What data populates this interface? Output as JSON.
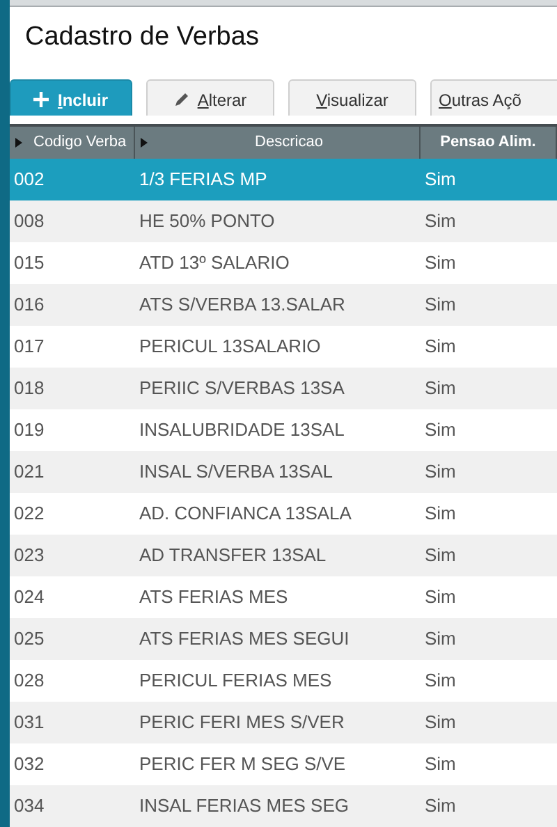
{
  "title": "Cadastro de Verbas",
  "buttons": [
    {
      "label": "Incluir",
      "kind": "add"
    },
    {
      "label": "Alterar",
      "kind": "edit"
    },
    {
      "label": "Visualizar",
      "kind": "plain"
    },
    {
      "label": "Outras Açõ",
      "kind": "plain"
    }
  ],
  "table": {
    "columns": [
      {
        "label": "Codigo Verba",
        "sortable": true
      },
      {
        "label": "Descricao",
        "sortable": true
      },
      {
        "label": "Pensao Alim.",
        "sortable": false
      }
    ],
    "rows": [
      {
        "cells": [
          "002",
          "1/3 FERIAS MP",
          "Sim"
        ],
        "selected": true
      },
      {
        "cells": [
          "008",
          "HE 50% PONTO",
          "Sim"
        ],
        "selected": false
      },
      {
        "cells": [
          "015",
          "ATD 13º SALARIO",
          "Sim"
        ],
        "selected": false
      },
      {
        "cells": [
          "016",
          "ATS S/VERBA 13.SALAR",
          "Sim"
        ],
        "selected": false
      },
      {
        "cells": [
          "017",
          "PERICUL 13SALARIO",
          "Sim"
        ],
        "selected": false
      },
      {
        "cells": [
          "018",
          "PERIIC S/VERBAS 13SA",
          "Sim"
        ],
        "selected": false
      },
      {
        "cells": [
          "019",
          "INSALUBRIDADE 13SAL",
          "Sim"
        ],
        "selected": false
      },
      {
        "cells": [
          "021",
          "INSAL S/VERBA 13SAL",
          "Sim"
        ],
        "selected": false
      },
      {
        "cells": [
          "022",
          "AD. CONFIANCA 13SALA",
          "Sim"
        ],
        "selected": false
      },
      {
        "cells": [
          "023",
          "AD TRANSFER 13SAL",
          "Sim"
        ],
        "selected": false
      },
      {
        "cells": [
          "024",
          "ATS FERIAS MES",
          "Sim"
        ],
        "selected": false
      },
      {
        "cells": [
          "025",
          "ATS FERIAS MES SEGUI",
          "Sim"
        ],
        "selected": false
      },
      {
        "cells": [
          "028",
          "PERICUL FERIAS MES",
          "Sim"
        ],
        "selected": false
      },
      {
        "cells": [
          "031",
          "PERIC FERI MES S/VER",
          "Sim"
        ],
        "selected": false
      },
      {
        "cells": [
          "032",
          "PERIC FER M SEG S/VE",
          "Sim"
        ],
        "selected": false
      },
      {
        "cells": [
          "034",
          "INSAL FERIAS MES SEG",
          "Sim"
        ],
        "selected": false
      }
    ]
  }
}
